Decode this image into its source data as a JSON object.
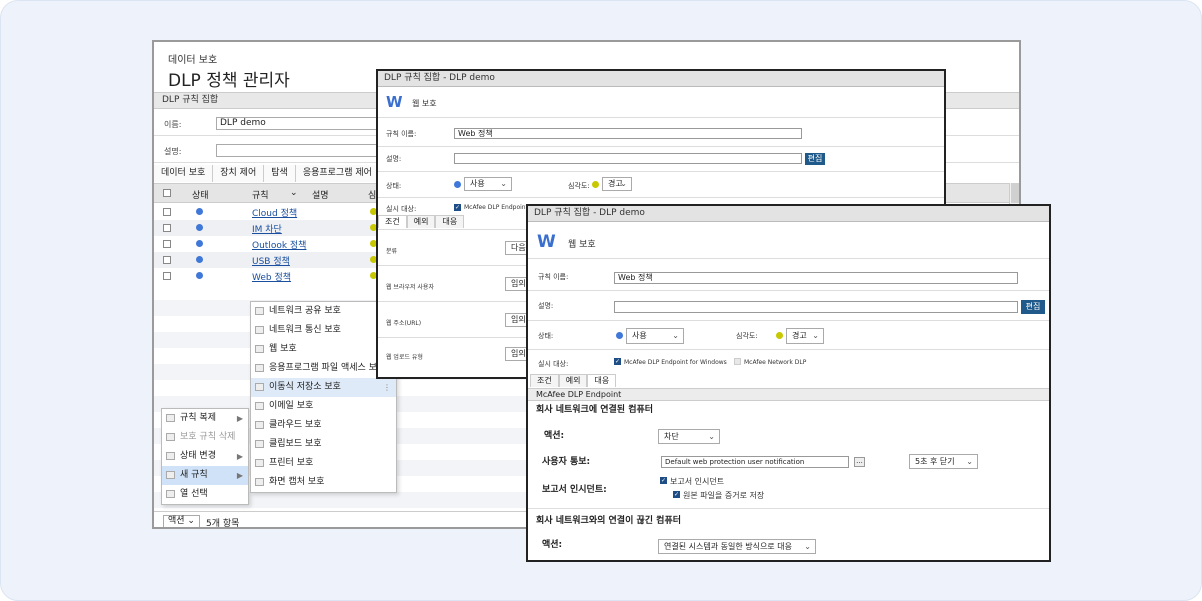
{
  "main": {
    "breadcrumb": "데이터 보호",
    "title": "DLP 정책 관리자",
    "section": "DLP 규칙 집합",
    "name_label": "이름:",
    "name_value": "DLP demo",
    "desc_label": "설명:",
    "tabs": [
      "데이터 보호",
      "장치 제어",
      "탐색",
      "응용프로그램 제어"
    ],
    "columns": {
      "status": "상태",
      "rule": "규칙",
      "desc": "설명",
      "sev": "심"
    },
    "rules": [
      "Cloud 정책",
      "IM 차단",
      "Outlook 정책",
      "USB 정책",
      "Web 정책"
    ],
    "footer_action": "액션",
    "footer_count": "5개 항목"
  },
  "context_menu": {
    "items": [
      {
        "label": "규칙 복제",
        "arrow": "▶"
      },
      {
        "label": "보호 규칙 삭제",
        "arrow": ""
      },
      {
        "label": "상태 변경",
        "arrow": "▶"
      },
      {
        "label": "새 규칙",
        "arrow": "▶"
      },
      {
        "label": "열 선택",
        "arrow": ""
      }
    ]
  },
  "submenu": {
    "items": [
      "네트워크 공유 보호",
      "네트워크 통신 보호",
      "웹 보호",
      "응용프로그램 파일 액세스 보호",
      "이동식 저장소 보호",
      "이메일 보호",
      "클라우드 보호",
      "클립보드 보호",
      "프린터 보호",
      "화면 캡처 보호"
    ]
  },
  "dialog1": {
    "title": "DLP 규칙 집합 - DLP demo",
    "heading": "웹 보호",
    "rule_name_label": "규칙 이름:",
    "rule_name_value": "Web 정책",
    "desc_label": "설명:",
    "edit_button": "편집",
    "state_label": "상태:",
    "state_value": "사용",
    "severity_label": "심각도:",
    "severity_value": "경고",
    "target_label": "실시 대상:",
    "target_value": "McAfee DLP Endpoint fo",
    "tabs": [
      "조건",
      "예외",
      "대응"
    ],
    "rows": [
      "분류",
      "웹 브라우저 사용자",
      "웹 주소(URL)",
      "웹 업로드 유형"
    ],
    "row_values": [
      "다음",
      "임의",
      "임의",
      "임의"
    ]
  },
  "dialog2": {
    "title": "DLP 규칙 집합 - DLP demo",
    "heading": "웹 보호",
    "rule_name_label": "규칙 이름:",
    "rule_name_value": "Web 정책",
    "desc_label": "설명:",
    "edit_button": "편집",
    "state_label": "상태:",
    "state_value": "사용",
    "severity_label": "심각도:",
    "severity_value": "경고",
    "target_label": "실시 대상:",
    "target_endpoint": "McAfee DLP Endpoint for Windows",
    "target_network": "McAfee Network DLP",
    "tabs": [
      "조건",
      "예외",
      "대응"
    ],
    "subheader": "McAfee DLP Endpoint",
    "section1": "회사 네트워크에 연결된 컴퓨터",
    "action_label": "액션:",
    "action_value": "차단",
    "notify_label": "사용자 통보:",
    "notify_value": "Default web protection user notification",
    "close_value": "5초 후 닫기",
    "report_label": "보고서 인시던트:",
    "report_check": "보고서 인시던트",
    "evidence_check": "원본 파일을 증거로 저장",
    "section2": "회사 네트워크와의 연결이 끊긴 컴퓨터",
    "action2_label": "액션:",
    "action2_value": "연결된 시스템과 동일한 방식으로 대응"
  }
}
